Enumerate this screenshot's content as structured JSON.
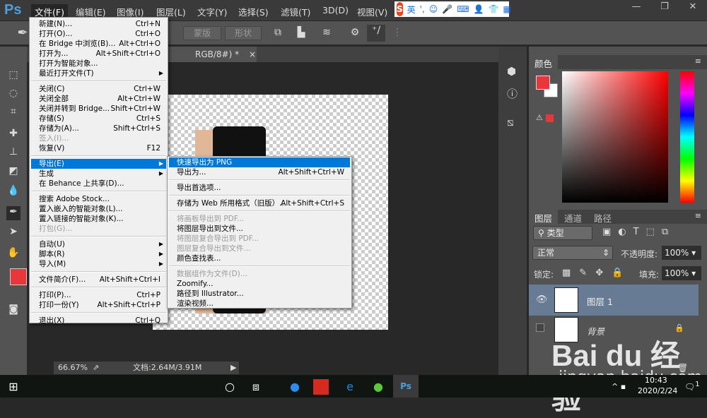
{
  "app": {
    "logo": "Ps"
  },
  "menubar": [
    "文件(F)",
    "编辑(E)",
    "图像(I)",
    "图层(L)",
    "文字(Y)",
    "选择(S)",
    "滤镜(T)",
    "3D(D)",
    "视图(V)"
  ],
  "ime": {
    "logo": "S",
    "mode": "英",
    "punct": "',"
  },
  "window_controls": [
    "—",
    "❐",
    "✕"
  ],
  "options": {
    "mask": "蒙版",
    "shape": "形状"
  },
  "document_tab": {
    "title": "RGB/8#) *",
    "close": "×"
  },
  "status": {
    "zoom": "66.67%",
    "doc": "文档:2.64M/3.91M"
  },
  "file_menu": [
    {
      "label": "新建(N)...",
      "sc": "Ctrl+N"
    },
    {
      "label": "打开(O)...",
      "sc": "Ctrl+O"
    },
    {
      "label": "在 Bridge 中浏览(B)...",
      "sc": "Alt+Ctrl+O"
    },
    {
      "label": "打开为...",
      "sc": "Alt+Shift+Ctrl+O"
    },
    {
      "label": "打开为智能对象..."
    },
    {
      "label": "最近打开文件(T)",
      "sub": true
    },
    {
      "sep": true
    },
    {
      "label": "关闭(C)",
      "sc": "Ctrl+W"
    },
    {
      "label": "关闭全部",
      "sc": "Alt+Ctrl+W"
    },
    {
      "label": "关闭并转到 Bridge...",
      "sc": "Shift+Ctrl+W"
    },
    {
      "label": "存储(S)",
      "sc": "Ctrl+S"
    },
    {
      "label": "存储为(A)...",
      "sc": "Shift+Ctrl+S"
    },
    {
      "label": "签入(I)...",
      "dis": true
    },
    {
      "label": "恢复(V)",
      "sc": "F12"
    },
    {
      "sep": true
    },
    {
      "label": "导出(E)",
      "sub": true,
      "hl": true
    },
    {
      "label": "生成",
      "sub": true
    },
    {
      "label": "在 Behance 上共享(D)..."
    },
    {
      "sep": true
    },
    {
      "label": "搜索 Adobe Stock..."
    },
    {
      "label": "置入嵌入的智能对象(L)..."
    },
    {
      "label": "置入链接的智能对象(K)..."
    },
    {
      "label": "打包(G)...",
      "dis": true
    },
    {
      "sep": true
    },
    {
      "label": "自动(U)",
      "sub": true
    },
    {
      "label": "脚本(R)",
      "sub": true
    },
    {
      "label": "导入(M)",
      "sub": true
    },
    {
      "sep": true
    },
    {
      "label": "文件简介(F)...",
      "sc": "Alt+Shift+Ctrl+I"
    },
    {
      "sep": true
    },
    {
      "label": "打印(P)...",
      "sc": "Ctrl+P"
    },
    {
      "label": "打印一份(Y)",
      "sc": "Alt+Shift+Ctrl+P"
    },
    {
      "sep": true
    },
    {
      "label": "退出(X)",
      "sc": "Ctrl+Q"
    }
  ],
  "export_menu": [
    {
      "label": "快速导出为 PNG",
      "hl": true
    },
    {
      "label": "导出为...",
      "sc": "Alt+Shift+Ctrl+W"
    },
    {
      "sep": true
    },
    {
      "label": "导出首选项..."
    },
    {
      "sep": true
    },
    {
      "label": "存储为 Web 所用格式（旧版）...",
      "sc": "Alt+Shift+Ctrl+S"
    },
    {
      "sep": true
    },
    {
      "label": "将画板导出到 PDF...",
      "dis": true
    },
    {
      "label": "将图层导出到文件..."
    },
    {
      "label": "将图层复合导出到 PDF...",
      "dis": true
    },
    {
      "label": "图层复合导出到文件...",
      "dis": true
    },
    {
      "label": "颜色查找表..."
    },
    {
      "sep": true
    },
    {
      "label": "数据组作为文件(D)...",
      "dis": true
    },
    {
      "label": "Zoomify..."
    },
    {
      "label": "路径到 Illustrator..."
    },
    {
      "label": "渲染视频..."
    }
  ],
  "color_panel": {
    "tab": "颜色",
    "foreground": "#e8363a"
  },
  "layers_panel": {
    "tabs": [
      "图层",
      "通道",
      "路径"
    ],
    "filter": "类型",
    "blend": "正常",
    "opacity_label": "不透明度:",
    "opacity": "100%",
    "lock_label": "锁定:",
    "fill_label": "填充:",
    "fill": "100%",
    "layers": [
      {
        "name": "图层 1",
        "selected": true,
        "visible": true
      },
      {
        "name": "背景",
        "selected": false,
        "visible": false,
        "locked": true
      }
    ]
  },
  "taskbar": {
    "time": "10:43",
    "date": "2020/2/24",
    "notif": "1"
  },
  "watermark": {
    "logo": "Bai du 经验",
    "url": "jingyan.baidu.com"
  }
}
